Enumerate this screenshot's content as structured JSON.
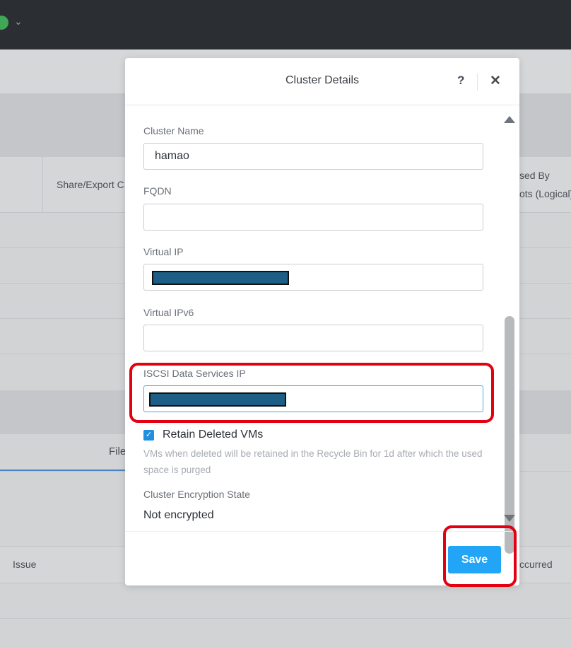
{
  "background": {
    "share_export_header": "Share/Export C",
    "used_by_header_line1": "sed By",
    "used_by_header_line2": "ots (Logical)",
    "tab_partial": "File",
    "issue_header": "Issue",
    "occurred_header": "ccurred"
  },
  "modal": {
    "title": "Cluster Details",
    "help_glyph": "?",
    "close_glyph": "✕",
    "fields": {
      "cluster_name": {
        "label": "Cluster Name",
        "value": "hamao"
      },
      "fqdn": {
        "label": "FQDN",
        "value": ""
      },
      "virtual_ip": {
        "label": "Virtual IP",
        "value": ""
      },
      "virtual_ipv6": {
        "label": "Virtual IPv6",
        "value": ""
      },
      "iscsi_ip": {
        "label": "ISCSI Data Services IP",
        "value": ""
      }
    },
    "retain_deleted_vms": {
      "label": "Retain Deleted VMs",
      "checked": true,
      "helper": "VMs when deleted will be retained in the Recycle Bin for 1d after which the used space is purged"
    },
    "encryption": {
      "label": "Cluster Encryption State",
      "value": "Not encrypted"
    },
    "save_label": "Save"
  },
  "colors": {
    "accent": "#22a5f7",
    "highlight": "#e3000f",
    "redaction": "#1c5e86",
    "topbar": "#2b2e33"
  }
}
